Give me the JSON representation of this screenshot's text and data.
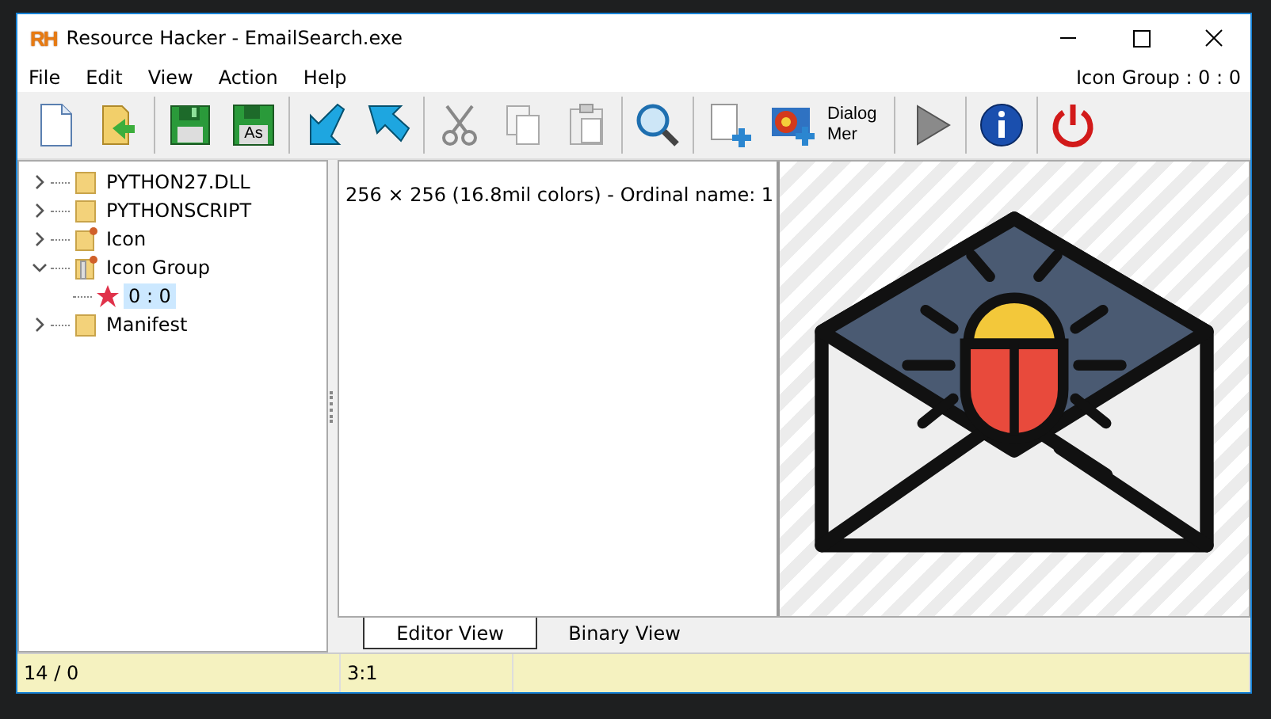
{
  "window": {
    "logo": "RH",
    "title": "Resource Hacker - EmailSearch.exe"
  },
  "menu": [
    {
      "label": "File"
    },
    {
      "label": "Edit"
    },
    {
      "label": "View"
    },
    {
      "label": "Action"
    },
    {
      "label": "Help"
    }
  ],
  "current_resource": "Icon Group : 0 : 0",
  "toolbar": [
    {
      "kind": "new"
    },
    {
      "kind": "open"
    },
    {
      "kind": "sep"
    },
    {
      "kind": "save"
    },
    {
      "kind": "saveas",
      "label": "As"
    },
    {
      "kind": "sep"
    },
    {
      "kind": "import"
    },
    {
      "kind": "export"
    },
    {
      "kind": "sep"
    },
    {
      "kind": "cut"
    },
    {
      "kind": "copy"
    },
    {
      "kind": "paste"
    },
    {
      "kind": "sep"
    },
    {
      "kind": "find"
    },
    {
      "kind": "sep"
    },
    {
      "kind": "addblank"
    },
    {
      "kind": "addimage"
    },
    {
      "kind": "dialog",
      "label": "Dialog Mer"
    },
    {
      "kind": "sep"
    },
    {
      "kind": "run"
    },
    {
      "kind": "sep"
    },
    {
      "kind": "info"
    },
    {
      "kind": "sep"
    },
    {
      "kind": "power"
    }
  ],
  "tree": [
    {
      "label": "PYTHON27.DLL",
      "kind": "folder",
      "expanded": false,
      "selected": false
    },
    {
      "label": "PYTHONSCRIPT",
      "kind": "folder",
      "expanded": false,
      "selected": false
    },
    {
      "label": "Icon",
      "kind": "folder-star",
      "expanded": false,
      "selected": false
    },
    {
      "label": "Icon Group",
      "kind": "folder-open-star",
      "expanded": true,
      "selected": false,
      "children": [
        {
          "label": "0 : 0",
          "kind": "star",
          "selected": true
        }
      ]
    },
    {
      "label": "Manifest",
      "kind": "folder",
      "expanded": false,
      "selected": false
    }
  ],
  "editor": {
    "text": "256 × 256 (16.8mil colors) - Ordinal name: 1"
  },
  "tabs": [
    {
      "label": "Editor View",
      "selected": true
    },
    {
      "label": "Binary View",
      "selected": false
    }
  ],
  "status_bar": [
    "14 / 0",
    "3:1"
  ]
}
